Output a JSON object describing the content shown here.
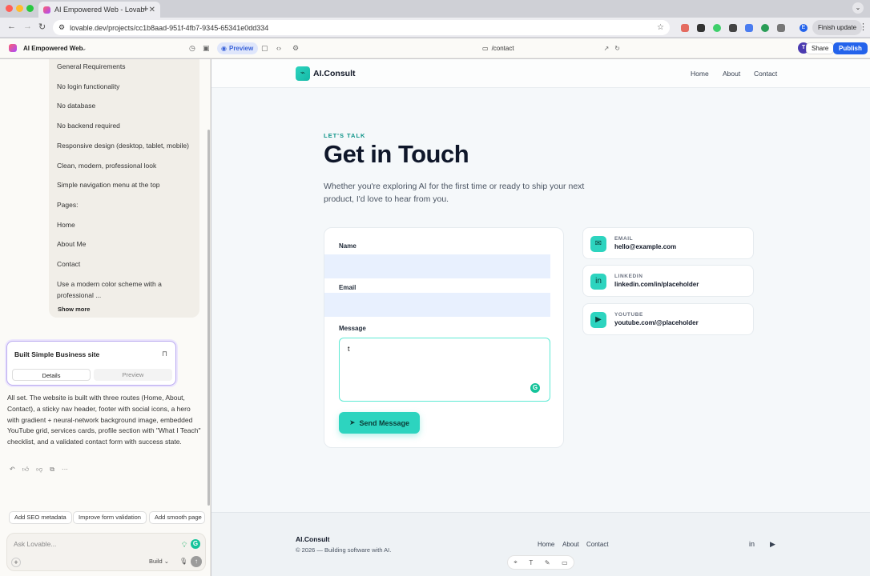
{
  "browser": {
    "tab_title": "AI Empowered Web - Lovable",
    "tab_close": "✕",
    "new_tab": "+",
    "url": "lovable.dev/projects/cc1b8aad-951f-4fb7-9345-65341e0dd334",
    "finish_update": "Finish update",
    "profile_initial": "E"
  },
  "app": {
    "project_name": "AI Empowered Web",
    "preview_label": "Preview",
    "route": "/contact",
    "avatar_initial": "T",
    "share": "Share",
    "publish": "Publish"
  },
  "chat": {
    "requirements": [
      "General Requirements",
      "No login functionality",
      "No database",
      "No backend required",
      "Responsive design (desktop, tablet, mobile)",
      "Clean, modern, professional look",
      "Simple navigation menu at the top",
      "Pages:",
      "Home",
      "About Me",
      "Contact",
      "Use a modern color scheme with a",
      "professional ..."
    ],
    "show_more": "Show more",
    "card_title": "Built Simple Business site",
    "card_details": "Details",
    "card_preview": "Preview",
    "answer": "All set. The website is built with three routes (Home, About, Contact), a sticky nav header, footer with social icons, a hero with gradient + neural-network background image, embedded YouTube grid, services cards, profile section with \"What I Teach\" checklist, and a validated contact form with success state.",
    "chips": [
      "Add SEO metadata",
      "Improve form validation",
      "Add smooth page"
    ],
    "ask_placeholder": "Ask Lovable...",
    "build_mode": "Build",
    "grammarly": "G"
  },
  "site": {
    "brand": "AI.Consult",
    "nav": [
      "Home",
      "About",
      "Contact"
    ],
    "eyebrow": "LET'S TALK",
    "headline": "Get in Touch",
    "lead": "Whether you're exploring AI for the first time or ready to ship your next product, I'd love to hear from you.",
    "form": {
      "name_label": "Name",
      "email_label": "Email",
      "message_label": "Message",
      "message_value": "t",
      "send": "Send Message"
    },
    "contacts": [
      {
        "key": "EMAIL",
        "value": "hello@example.com",
        "icon": "mail-icon"
      },
      {
        "key": "LINKEDIN",
        "value": "linkedin.com/in/placeholder",
        "icon": "linkedin-icon"
      },
      {
        "key": "YOUTUBE",
        "value": "youtube.com/@placeholder",
        "icon": "youtube-icon"
      }
    ],
    "footer": {
      "brand": "AI.Consult",
      "copyright": "© 2026 — Building software with AI.",
      "links": [
        "Home",
        "About",
        "Contact"
      ]
    }
  },
  "colors": {
    "accent": "#2dd4bf",
    "publish": "#2463eb",
    "card_border": "#b9a9ef"
  }
}
